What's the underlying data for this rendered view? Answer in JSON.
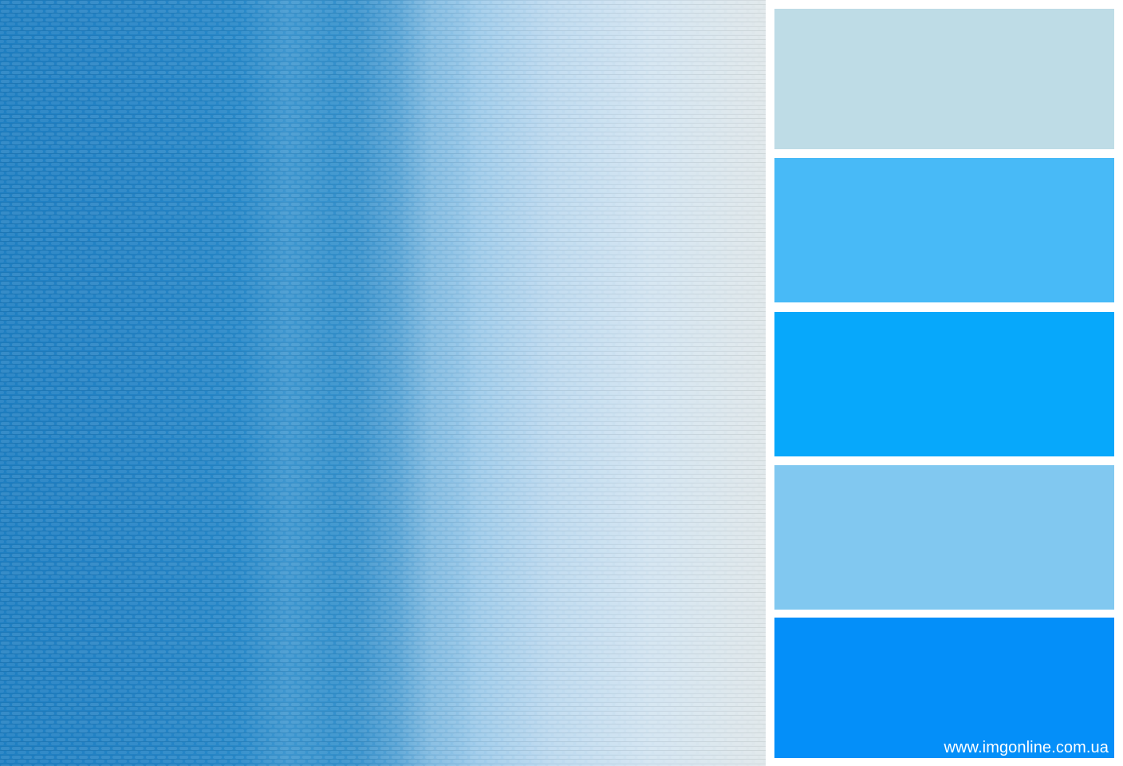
{
  "palette": {
    "colors": [
      "#bedcE6",
      "#48baf7",
      "#07a8fb",
      "#81c8f0",
      "#048ff9"
    ]
  },
  "photo": {
    "gradient_from": "#1f7fc2",
    "gradient_to": "#dfe7ea"
  },
  "watermark": {
    "text": "www.imgonline.com.ua"
  }
}
